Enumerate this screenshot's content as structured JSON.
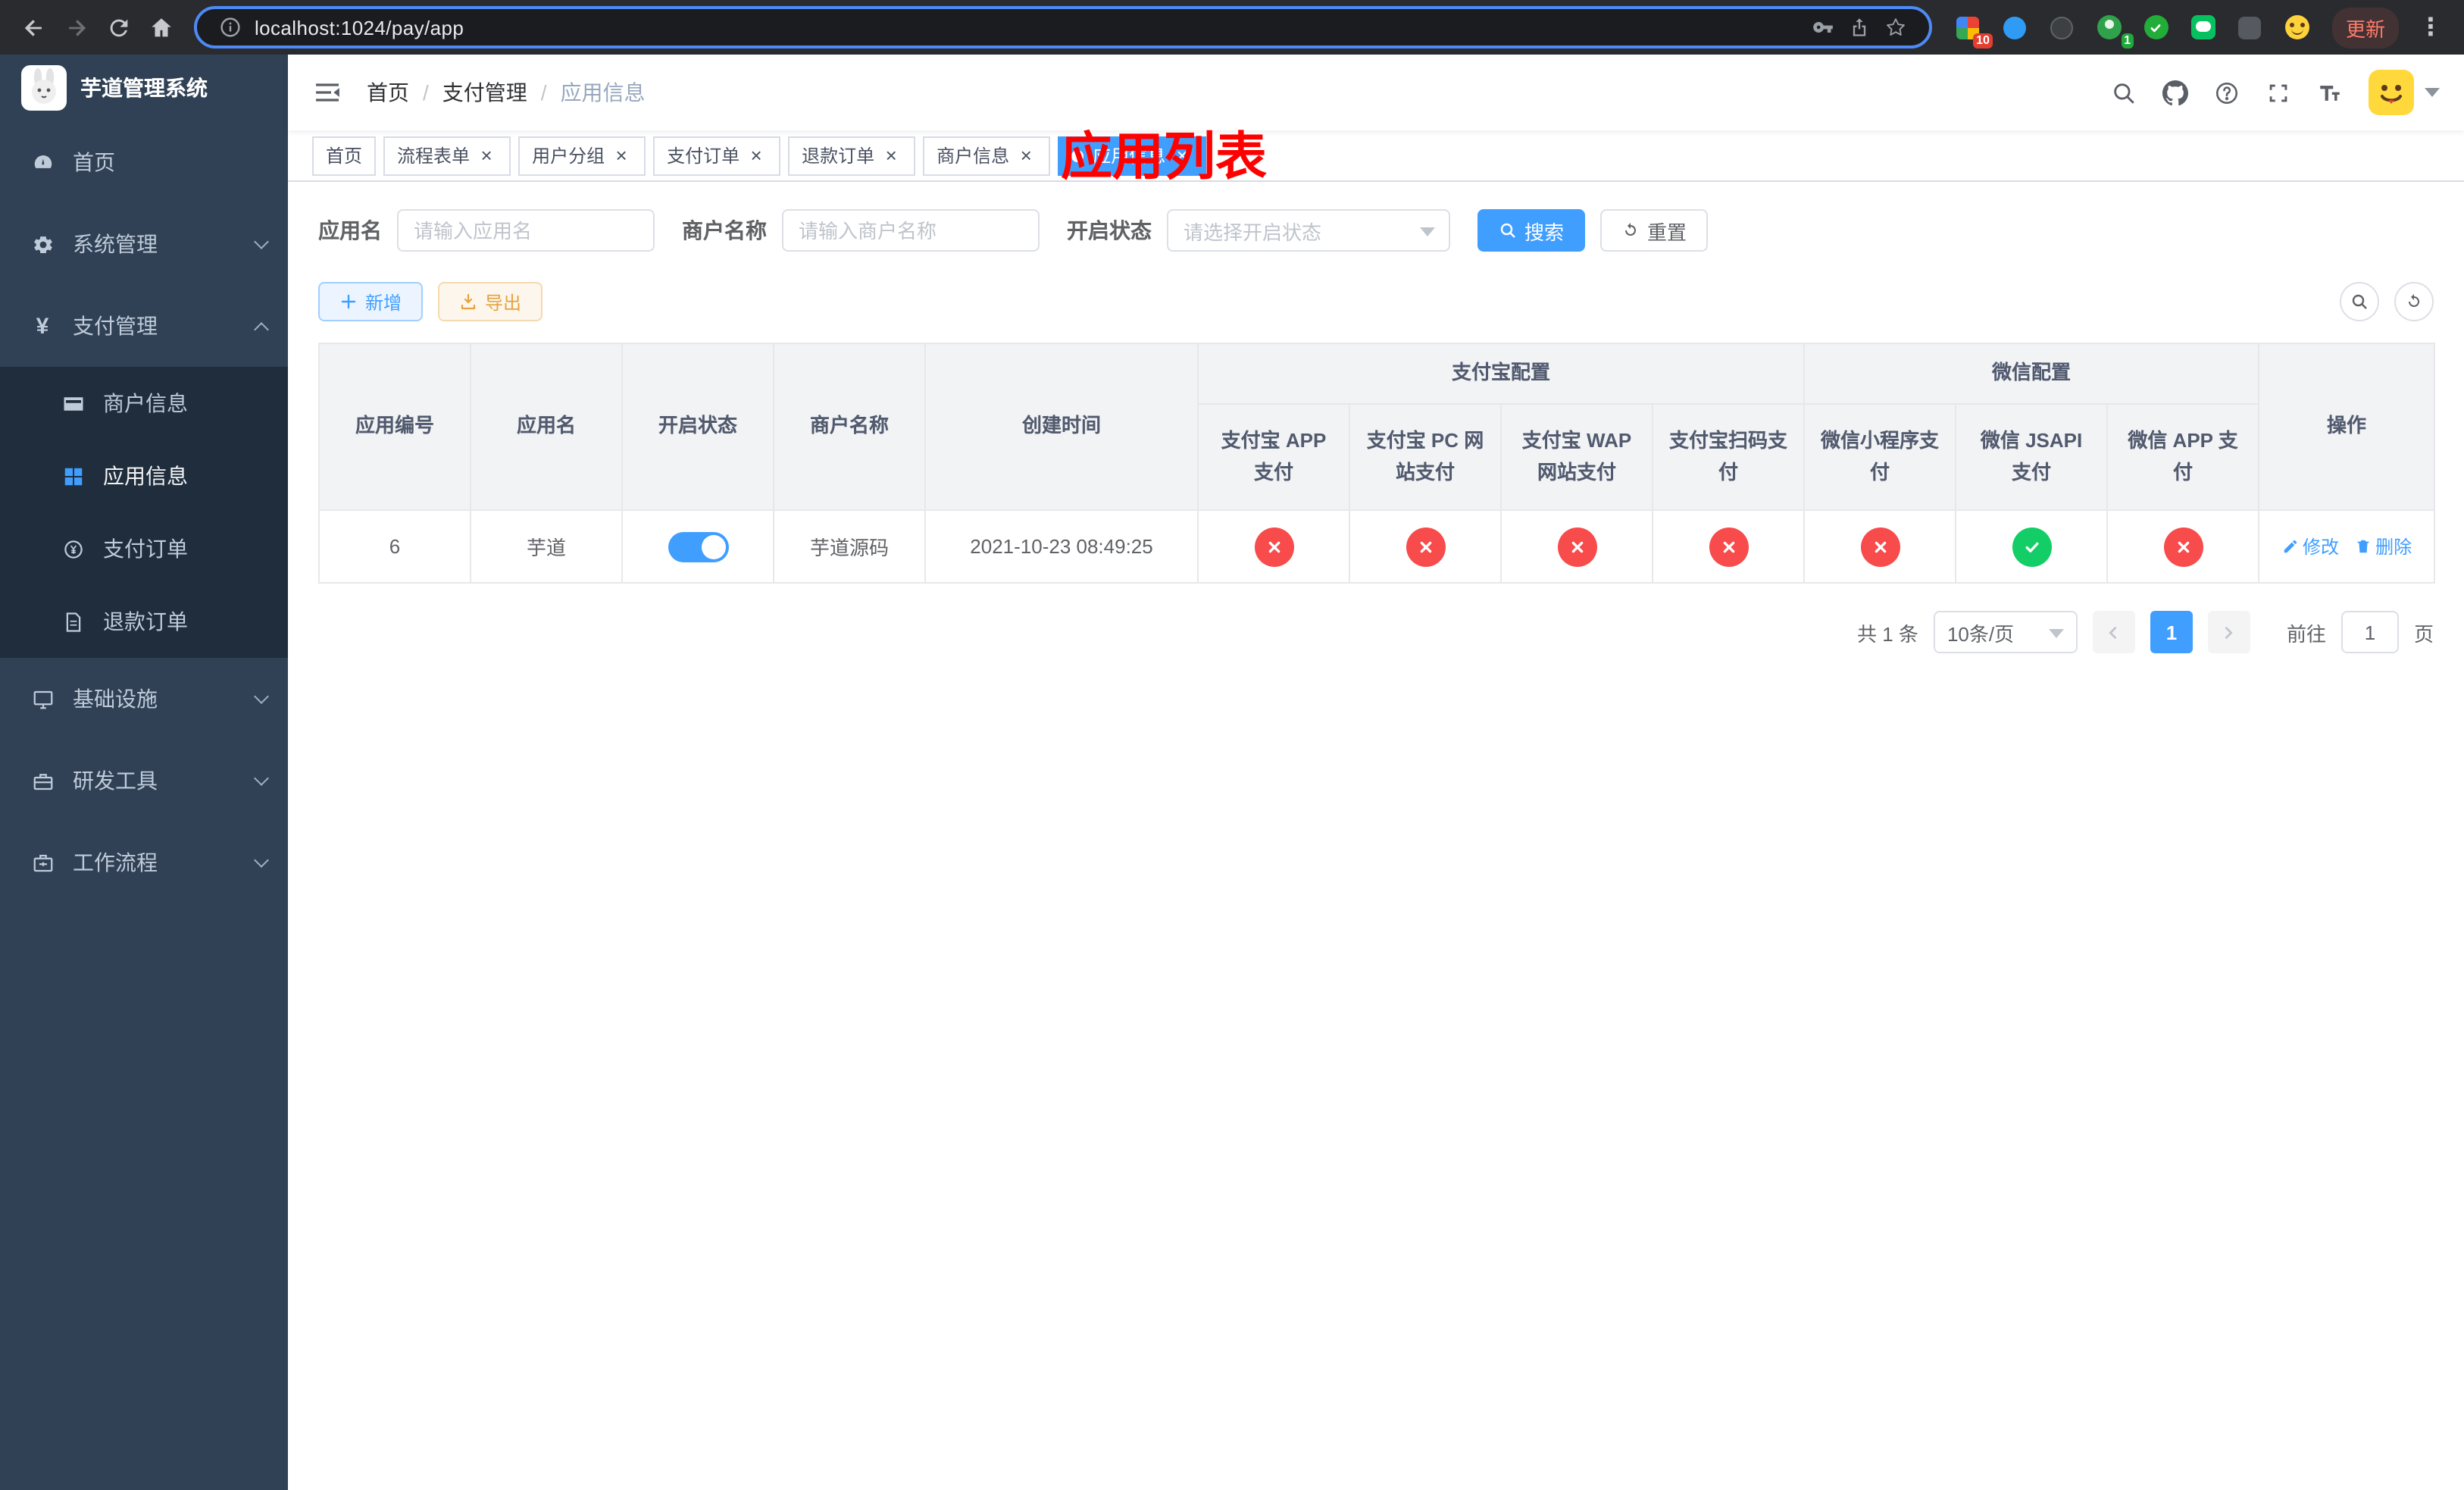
{
  "browser": {
    "url": "localhost:1024/pay/app",
    "update_label": "更新",
    "extension_badges": {
      "first": "10",
      "second": "1"
    }
  },
  "icons": {
    "menu_dots_glyph": "⋮",
    "close_glyph": "×",
    "yen_glyph": "¥"
  },
  "app": {
    "title": "芋道管理系统"
  },
  "sidebar": {
    "items": [
      {
        "label": "首页"
      },
      {
        "label": "系统管理"
      },
      {
        "label": "支付管理"
      },
      {
        "label": "商户信息"
      },
      {
        "label": "应用信息"
      },
      {
        "label": "支付订单"
      },
      {
        "label": "退款订单"
      },
      {
        "label": "基础设施"
      },
      {
        "label": "研发工具"
      },
      {
        "label": "工作流程"
      }
    ]
  },
  "header": {
    "breadcrumb": [
      "首页",
      "支付管理",
      "应用信息"
    ],
    "breadcrumb_separator": "/",
    "overlay_title": "应用列表"
  },
  "tabs": [
    {
      "label": "首页"
    },
    {
      "label": "流程表单"
    },
    {
      "label": "用户分组"
    },
    {
      "label": "支付订单"
    },
    {
      "label": "退款订单"
    },
    {
      "label": "商户信息"
    },
    {
      "label": "应用信息"
    }
  ],
  "filters": {
    "app_name_label": "应用名",
    "app_name_placeholder": "请输入应用名",
    "merchant_label": "商户名称",
    "merchant_placeholder": "请输入商户名称",
    "status_label": "开启状态",
    "status_placeholder": "请选择开启状态",
    "search_label": "搜索",
    "reset_label": "重置"
  },
  "toolbar": {
    "add_label": "新增",
    "export_label": "导出"
  },
  "table": {
    "columns": [
      "应用编号",
      "应用名",
      "开启状态",
      "商户名称",
      "创建时间"
    ],
    "groups": {
      "alipay": {
        "label": "支付宝配置",
        "cols": [
          "支付宝 APP 支付",
          "支付宝 PC 网站支付",
          "支付宝 WAP 网站支付",
          "支付宝扫码支付"
        ]
      },
      "wechat": {
        "label": "微信配置",
        "cols": [
          "微信小程序支付",
          "微信 JSAPI 支付",
          "微信 APP 支付"
        ]
      }
    },
    "action_label": "操作",
    "rows": [
      {
        "id": "6",
        "name": "芋道",
        "enabled": true,
        "merchant": "芋道源码",
        "created": "2021-10-23 08:49:25",
        "configs": [
          false,
          false,
          false,
          false,
          false,
          true,
          false
        ],
        "edit_label": "修改",
        "delete_label": "删除"
      }
    ]
  },
  "pagination": {
    "total": "共 1 条",
    "page_size": "10条/页",
    "page": "1",
    "goto_label": "前往",
    "goto_value": "1",
    "unit_label": "页"
  }
}
